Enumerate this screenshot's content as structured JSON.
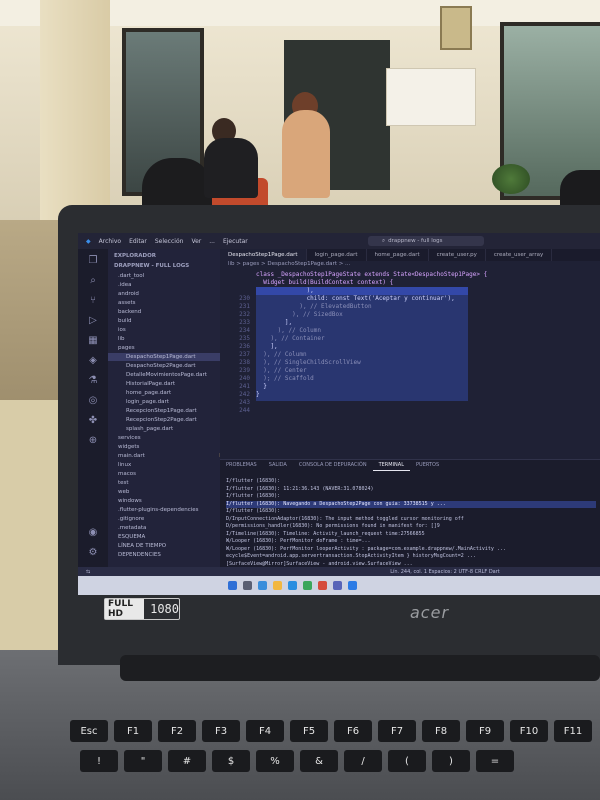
{
  "window": {
    "menu": [
      "Archivo",
      "Editar",
      "Selección",
      "Ver",
      "...",
      "Ejecutar"
    ],
    "search": "drappnew - full logs"
  },
  "explorer": {
    "title": "EXPLORADOR",
    "project": "DRAPPNEW - FULL LOGS",
    "items": [
      {
        "label": ".dart_tool",
        "mod": "",
        "sel": false
      },
      {
        "label": ".idea",
        "mod": "",
        "sel": false
      },
      {
        "label": "android",
        "mod": "•",
        "sel": false
      },
      {
        "label": "assets",
        "mod": "•",
        "sel": false
      },
      {
        "label": "backend",
        "mod": "•",
        "sel": false
      },
      {
        "label": "build",
        "mod": "",
        "sel": false
      },
      {
        "label": "ios",
        "mod": "",
        "sel": false
      },
      {
        "label": "lib",
        "mod": "•",
        "sel": false
      },
      {
        "label": "pages",
        "mod": "",
        "sel": false
      },
      {
        "label": "DespachoStep1Page.dart",
        "mod": "M",
        "sel": true
      },
      {
        "label": "DespachoStep2Page.dart",
        "mod": "M",
        "sel": false
      },
      {
        "label": "DetalleMovimientosPage.dart",
        "mod": "M",
        "sel": false
      },
      {
        "label": "HistorialPage.dart",
        "mod": "M",
        "sel": false
      },
      {
        "label": "home_page.dart",
        "mod": "M",
        "sel": false
      },
      {
        "label": "login_page.dart",
        "mod": "M",
        "sel": false
      },
      {
        "label": "RecepcionStep1Page.dart",
        "mod": "M",
        "sel": false
      },
      {
        "label": "RecepcionStep2Page.dart",
        "mod": "",
        "sel": false
      },
      {
        "label": "splash_page.dart",
        "mod": "",
        "sel": false
      },
      {
        "label": "services",
        "mod": "•",
        "sel": false
      },
      {
        "label": "widgets",
        "mod": "",
        "sel": false
      },
      {
        "label": "main.dart",
        "mod": "M",
        "sel": false
      },
      {
        "label": "linux",
        "mod": "",
        "sel": false
      },
      {
        "label": "macos",
        "mod": "",
        "sel": false
      },
      {
        "label": "test",
        "mod": "",
        "sel": false
      },
      {
        "label": "web",
        "mod": "",
        "sel": false
      },
      {
        "label": "windows",
        "mod": "",
        "sel": false
      },
      {
        "label": ".flutter-plugins-dependencies",
        "mod": "",
        "sel": false
      },
      {
        "label": ".gitignore",
        "mod": "",
        "sel": false
      },
      {
        "label": ".metadata",
        "mod": "",
        "sel": false
      },
      {
        "label": "ESQUEMA",
        "mod": "",
        "sel": false
      },
      {
        "label": "LÍNEA DE TIEMPO",
        "mod": "",
        "sel": false
      },
      {
        "label": "DEPENDENCIES",
        "mod": "",
        "sel": false
      }
    ]
  },
  "editor": {
    "tabs": [
      {
        "label": "DespachoStep1Page.dart",
        "active": true
      },
      {
        "label": "login_page.dart",
        "active": false
      },
      {
        "label": "home_page.dart",
        "active": false
      },
      {
        "label": "create_user.py",
        "active": false
      },
      {
        "label": "create_user_array",
        "active": false
      }
    ],
    "breadcrumb": "lib > pages > DespachoStep1Page.dart > ...",
    "lines": [
      {
        "n": "",
        "t": "class _DespachoStep1PageState extends State<DespachoStep1Page> {",
        "k": "kw"
      },
      {
        "n": "",
        "t": "  Widget build(BuildContext context) {",
        "k": "kw"
      },
      {
        "n": "",
        "t": "              ),",
        "k": ""
      },
      {
        "n": "230",
        "t": "              child: const Text('Aceptar y continuar'),",
        "k": ""
      },
      {
        "n": "231",
        "t": "            ), // ElevatedButton",
        "k": "cm"
      },
      {
        "n": "232",
        "t": "          ), // SizedBox",
        "k": "cm"
      },
      {
        "n": "233",
        "t": "        ],",
        "k": ""
      },
      {
        "n": "234",
        "t": "      ), // Column",
        "k": "cm"
      },
      {
        "n": "235",
        "t": "    ), // Container",
        "k": "cm"
      },
      {
        "n": "236",
        "t": "    ],",
        "k": ""
      },
      {
        "n": "237",
        "t": "  ), // Column",
        "k": "cm"
      },
      {
        "n": "238",
        "t": "  ), // SingleChildScrollView",
        "k": "cm"
      },
      {
        "n": "239",
        "t": "  ), // Center",
        "k": "cm"
      },
      {
        "n": "240",
        "t": "  ); // Scaffold",
        "k": "cm"
      },
      {
        "n": "241",
        "t": "  }",
        "k": ""
      },
      {
        "n": "242",
        "t": "}",
        "k": ""
      },
      {
        "n": "243",
        "t": "",
        "k": ""
      },
      {
        "n": "244",
        "t": "",
        "k": ""
      }
    ]
  },
  "panel": {
    "tabs": [
      {
        "label": "PROBLEMAS",
        "active": false
      },
      {
        "label": "SALIDA",
        "active": false
      },
      {
        "label": "CONSOLA DE DEPURACIÓN",
        "active": false
      },
      {
        "label": "TERMINAL",
        "active": true
      },
      {
        "label": "PUERTOS",
        "active": false
      }
    ],
    "lines": [
      {
        "t": "I/flutter (16830):",
        "hl": false
      },
      {
        "t": "I/flutter (16830): 11:21:36.143 (NAVER:31.078024)",
        "hl": false
      },
      {
        "t": "I/flutter (16830):",
        "hl": false
      },
      {
        "t": "I/flutter (16830): Navegando a DespachoStep2Page con guía: 33738515 y ...",
        "hl": true
      },
      {
        "t": "I/flutter (16830):",
        "hl": false
      },
      {
        "t": "D/InputConnectionAdaptor(16830): The input method toggled cursor monitoring off",
        "hl": false
      },
      {
        "t": "D/permissions_handler(16830): No permissions found in manifest for: []9",
        "hl": false
      },
      {
        "t": "I/Timeline(16830): Timeline: Activity_launch_request time:27566855",
        "hl": false
      },
      {
        "t": "W/Looper  (16830): PerfMonitor doFrame : time=...",
        "hl": false
      },
      {
        "t": "W/Looper  (16830): PerfMonitor looperActivity : package=com.example.drappnew/.MainActivity ...",
        "hl": false
      },
      {
        "t": "ecycle$Event=android.app.servertransaction.StopActivityItem } historyMsgCount=2 ...",
        "hl": false
      },
      {
        "t": "[SurfaceView@Mirror]SurfaceView - android.view.SurfaceView ...",
        "hl": false
      }
    ]
  },
  "status": "Lín. 244, col. 1   Espacios: 2   UTF-8   CRLF   Dart",
  "laptop": {
    "badge_hd": "FULL HD",
    "badge_res": "1080",
    "brand": "acer"
  },
  "keys": [
    "Esc",
    "F1",
    "F2",
    "F3",
    "F4",
    "F5",
    "F6",
    "F7",
    "F8",
    "F9",
    "F10",
    "F11",
    "!",
    "\"",
    "#",
    "$",
    "%",
    "&",
    "/",
    "(",
    ")",
    "="
  ]
}
